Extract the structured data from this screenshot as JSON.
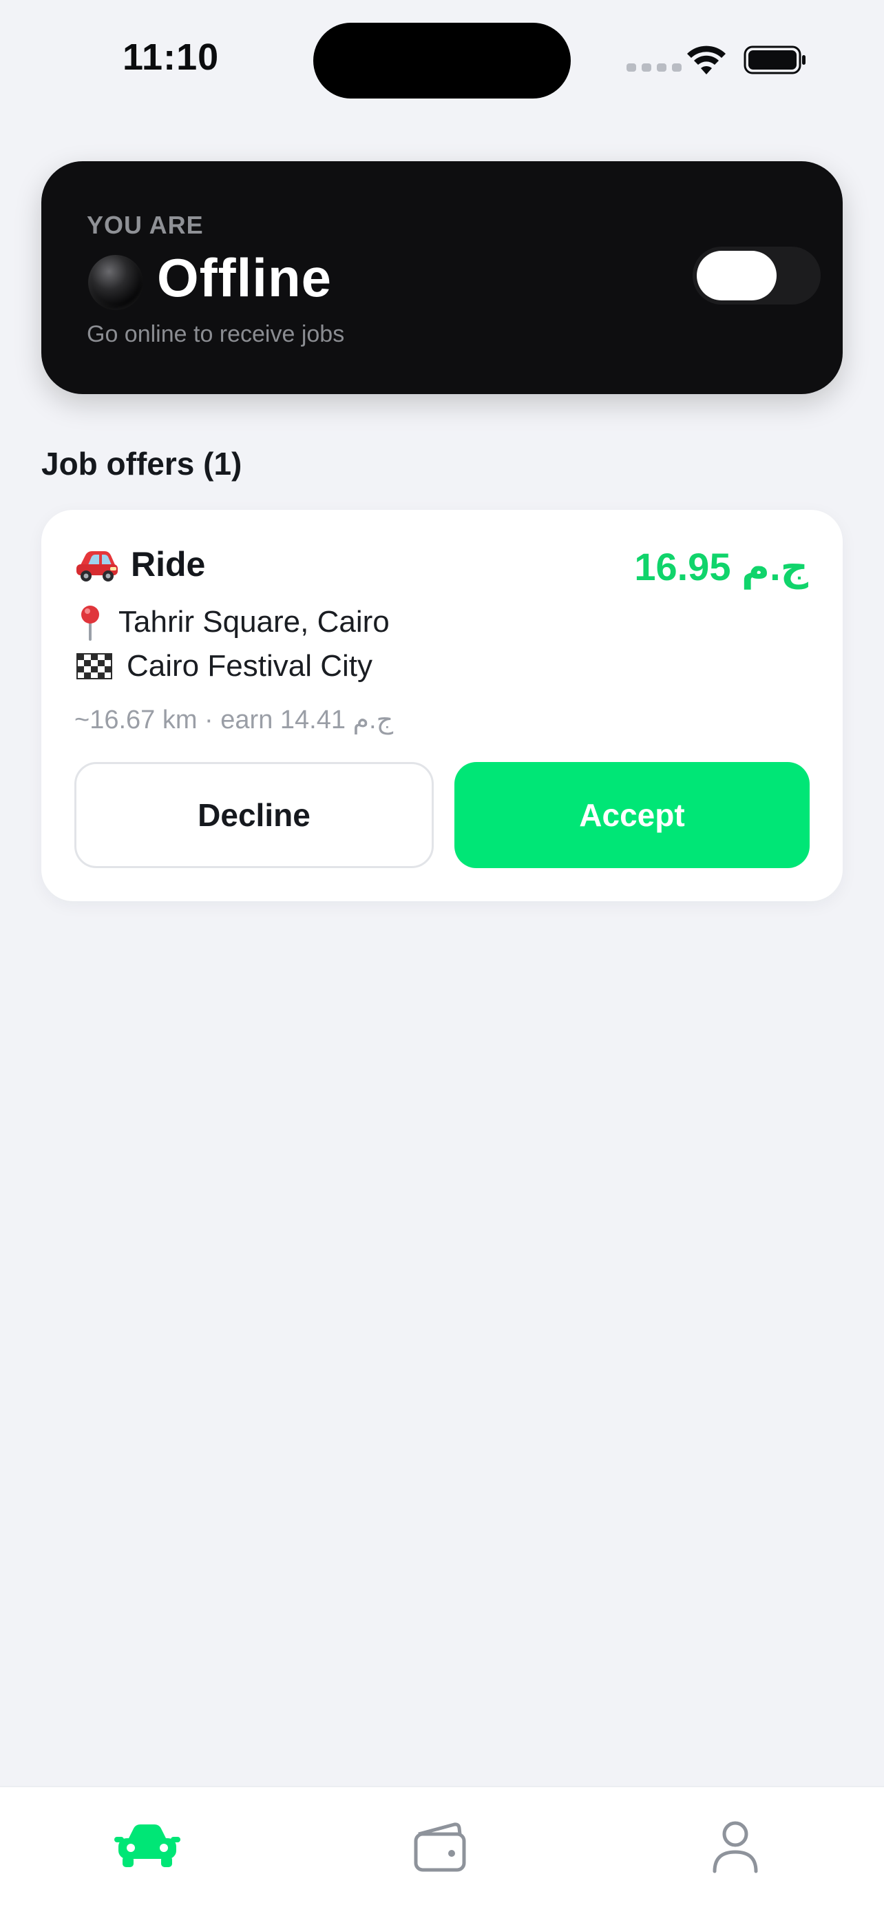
{
  "status_bar": {
    "time": "11:10"
  },
  "driver_status": {
    "kicker": "YOU ARE",
    "title": "Offline",
    "subtitle": "Go online to receive jobs",
    "toggle_on": false
  },
  "offers": {
    "section_title": "Job offers (1)",
    "items": [
      {
        "type_label": "Ride",
        "type_icon": "car-icon",
        "price": "16.95 ج.م",
        "pickup": "Tahrir Square, Cairo",
        "dropoff": "Cairo Festival City",
        "meta": "~16.67 km · earn 14.41 ج.م",
        "decline_label": "Decline",
        "accept_label": "Accept"
      }
    ]
  },
  "tab_bar": {
    "tabs": [
      {
        "icon": "car-icon",
        "active": true
      },
      {
        "icon": "wallet-icon",
        "active": false
      },
      {
        "icon": "user-icon",
        "active": false
      }
    ]
  },
  "colors": {
    "accent": "#00e676",
    "price": "#10d46b",
    "status_card_bg": "#0e0e10",
    "page_bg": "#f2f3f7",
    "tab_inactive": "#8e939b"
  }
}
